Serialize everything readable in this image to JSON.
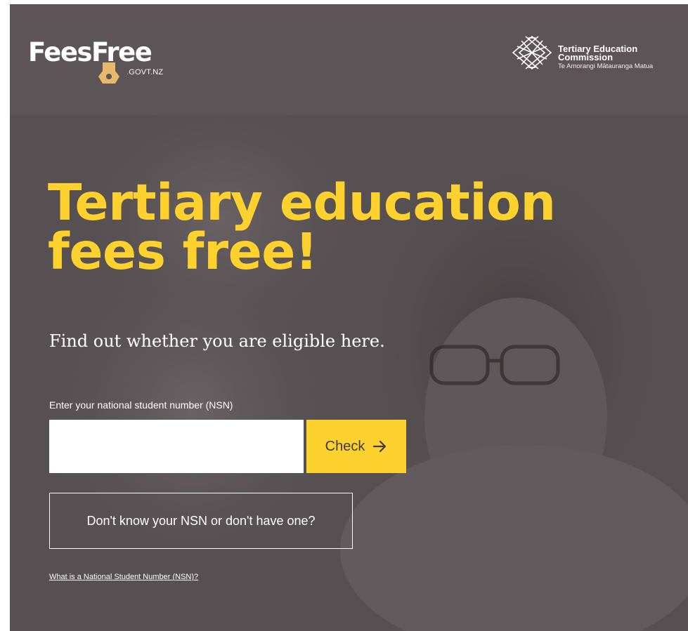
{
  "header": {
    "logo": {
      "name": "FeesFree",
      "suffix": ".GOVT.NZ",
      "icon": "key-icon"
    },
    "partner": {
      "line1": "Tertiary Education",
      "line2": "Commission",
      "line3": "Te Amorangi Mātauranga Matua",
      "icon": "tec-logo-mark"
    }
  },
  "hero": {
    "headline_line1": "Tertiary education",
    "headline_line2": "fees free!",
    "subhead": "Find out whether you are eligible here.",
    "nsn_label": "Enter your national student number (NSN)",
    "nsn_value": "",
    "nsn_placeholder": "",
    "check_label": "Check",
    "check_icon": "arrow-right-icon",
    "dont_know_label": "Don't know your NSN or don't have one?",
    "what_link": "What is a National Student Number (NSN)?"
  },
  "colors": {
    "accent": "#fdd22e",
    "header_bg": "#5c5456",
    "hero_bg": "#575052",
    "text_light": "#ffffff"
  }
}
